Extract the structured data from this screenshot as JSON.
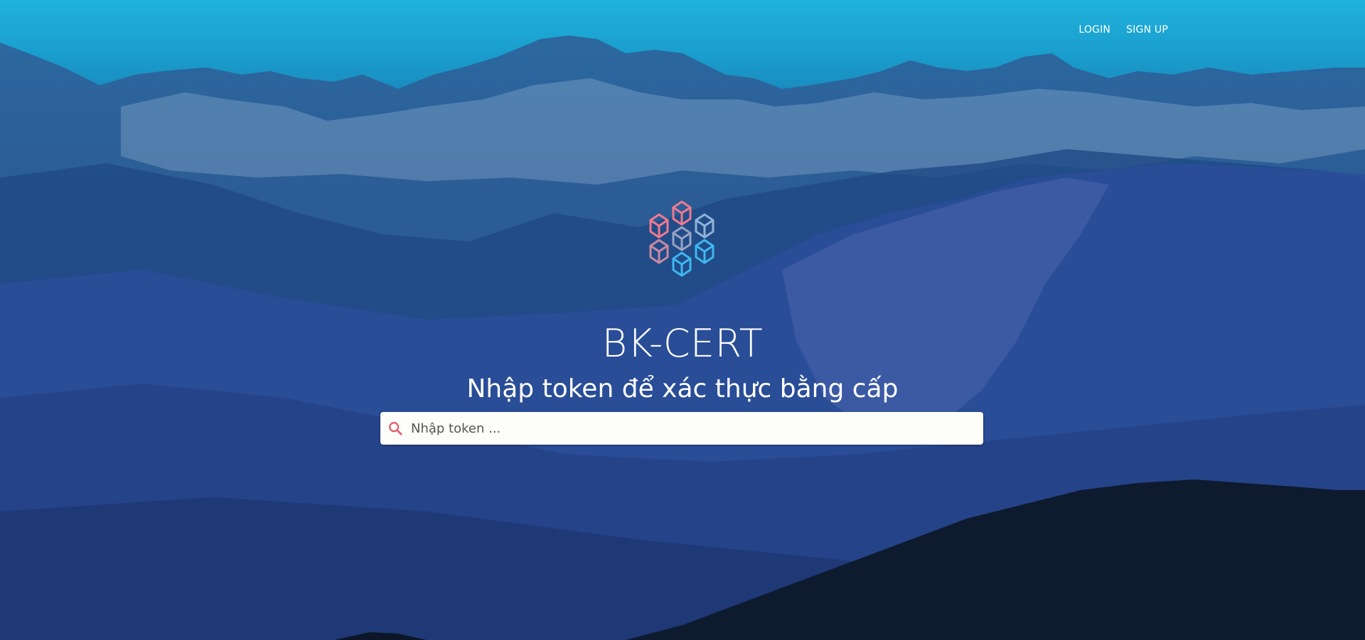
{
  "nav": {
    "login": "LOGIN",
    "signup": "SIGN UP"
  },
  "brand": {
    "name": "BK-CERT",
    "tagline": "Nhập token để xác thực bằng cấp"
  },
  "search": {
    "placeholder": "Nhập token ...",
    "value": "",
    "icon": "search-icon"
  },
  "colors": {
    "logo_pink": "#f07a8e",
    "logo_blue": "#3fb7ef",
    "logo_gray": "#9aa3c3",
    "search_icon": "#e8616f"
  }
}
